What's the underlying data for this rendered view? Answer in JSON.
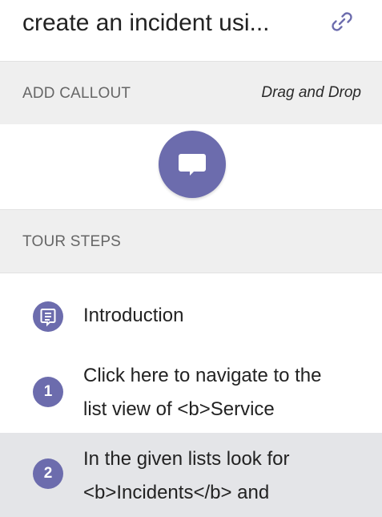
{
  "header": {
    "title": "create an incident usi...",
    "link_icon": "link-icon"
  },
  "add_callout": {
    "label": "ADD CALLOUT",
    "hint": "Drag and Drop",
    "button_icon": "comment-icon"
  },
  "tour_steps": {
    "label": "TOUR STEPS",
    "items": [
      {
        "badge": "",
        "icon": "intro-icon",
        "text": "Introduction",
        "selected": false
      },
      {
        "badge": "1",
        "text_line1": "Click here to navigate to the",
        "text_line2": "list view of <b>Service",
        "selected": false
      },
      {
        "badge": "2",
        "text_line1": "In the given lists look for",
        "text_line2": "<b>Incidents</b> and",
        "selected": true
      }
    ]
  },
  "colors": {
    "accent": "#6c6cad",
    "section_bg": "#efefef",
    "selected_bg": "#e4e5e8",
    "link_icon": "#6c6cad"
  }
}
